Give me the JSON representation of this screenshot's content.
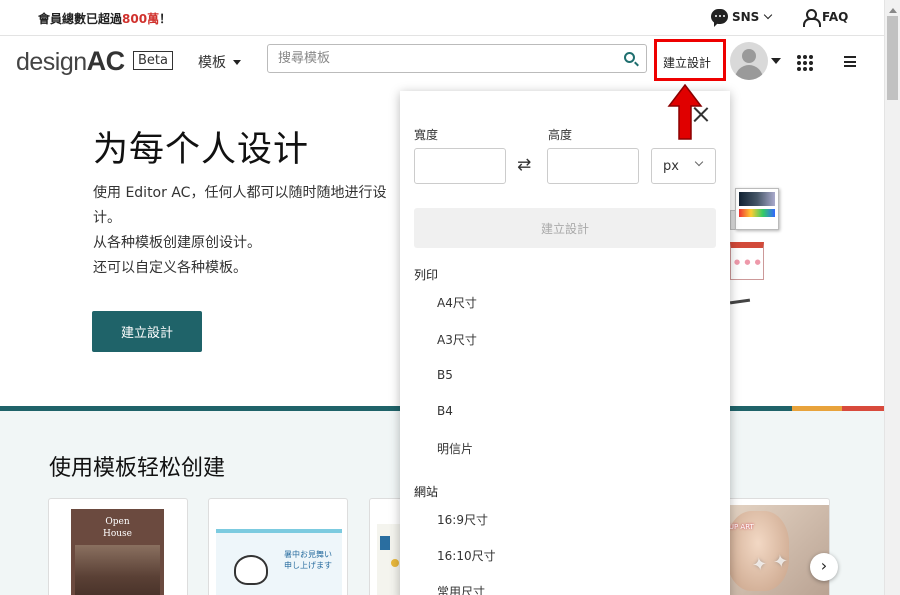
{
  "announcement": {
    "prefix": "會員總數已超過",
    "highlight": "800萬",
    "suffix": "！"
  },
  "topnav": {
    "sns_label": "SNS",
    "faq_label": "FAQ"
  },
  "header": {
    "logo_text": "design",
    "logo_mark": "AC",
    "beta": "Beta",
    "templates_menu": "模板",
    "search_placeholder": "搜尋模板",
    "create_button": "建立設計"
  },
  "hero": {
    "title": "为每个人设计",
    "line1": "使用 Editor AC，任何人都可以随时随地进行设计。",
    "line2": "从各种模板创建原创设计。",
    "line3": "还可以自定义各种模板。",
    "button": "建立設計"
  },
  "templates_section": {
    "title": "使用模板轻松创建",
    "cards": [
      {
        "line1": "Open",
        "line2": "House"
      },
      {
        "line1": "暑中お見舞い",
        "line2": "申し上げます"
      },
      {},
      {
        "text": "MAKEUP ART"
      }
    ]
  },
  "panel": {
    "width_label": "寬度",
    "height_label": "高度",
    "width_value": "",
    "height_value": "",
    "unit": "px",
    "create_button": "建立設計",
    "sections": [
      {
        "title": "列印",
        "options": [
          "A4尺寸",
          "A3尺寸",
          "B5",
          "B4",
          "明信片"
        ]
      },
      {
        "title": "網站",
        "options": [
          "16:9尺寸",
          "16:10尺寸",
          "常用尺寸"
        ]
      }
    ]
  },
  "colors": {
    "brand_teal": "#1f6369",
    "highlight_red": "#d0312d",
    "annotation_red": "#e00000"
  }
}
